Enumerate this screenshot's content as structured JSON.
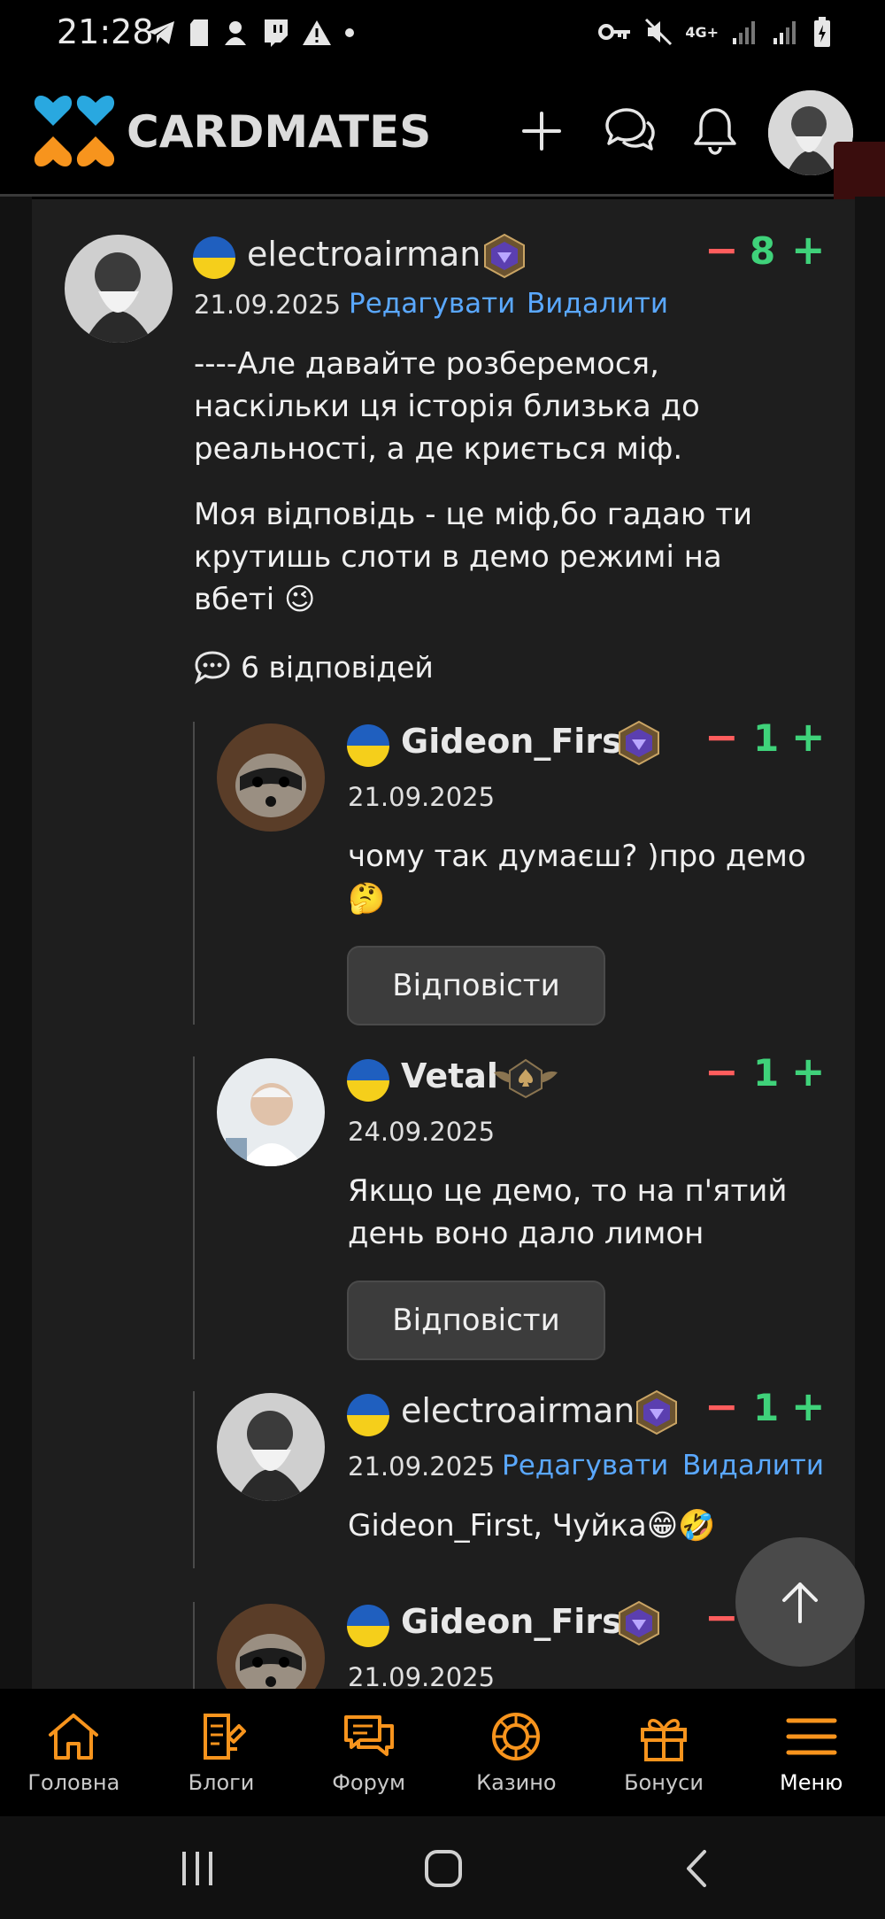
{
  "status_bar": {
    "time": "21:28",
    "network": "4G+"
  },
  "header": {
    "brand": "CARDMATES"
  },
  "comments": [
    {
      "username": "electroairman",
      "date": "21.09.2025",
      "edit": "Редагувати",
      "delete": "Видалити",
      "votes": "8",
      "paragraphs": [
        "----Але давайте розберемося, наскільки ця історія близька до реальності, а де криється міф.",
        "Моя відповідь - це міф,бо гадаю ти крутишь слоти в демо режимі на вбеті 😉"
      ],
      "replies_count": "6 відповідей"
    }
  ],
  "replies": [
    {
      "username": "Gideon_First",
      "date": "21.09.2025",
      "votes": "1",
      "text": "чому так думаєш? )про демо 🤔",
      "reply_label": "Відповісти"
    },
    {
      "username": "Vetal",
      "date": "24.09.2025",
      "votes": "1",
      "text": "Якщо це демо, то на п'ятий день воно дало лимон",
      "reply_label": "Відповісти"
    },
    {
      "username": "electroairman",
      "date": "21.09.2025",
      "edit": "Редагувати",
      "delete": "Видалити",
      "votes": "1",
      "text": "Gideon_First, Чуйка😁🤣"
    },
    {
      "username": "Gideon_First",
      "date": "21.09.2025"
    }
  ],
  "bottom_nav": [
    {
      "label": "Головна",
      "icon": "home-icon"
    },
    {
      "label": "Блоги",
      "icon": "blog-icon"
    },
    {
      "label": "Форум",
      "icon": "forum-icon"
    },
    {
      "label": "Казино",
      "icon": "casino-icon"
    },
    {
      "label": "Бонуси",
      "icon": "gift-icon"
    },
    {
      "label": "Меню",
      "icon": "menu-icon"
    }
  ],
  "colors": {
    "accent_orange": "#f7941d",
    "accent_blue": "#29a8e0",
    "vote_green": "#3fd27a",
    "vote_red": "#ff5d5d",
    "link_blue": "#5aa8ff"
  }
}
